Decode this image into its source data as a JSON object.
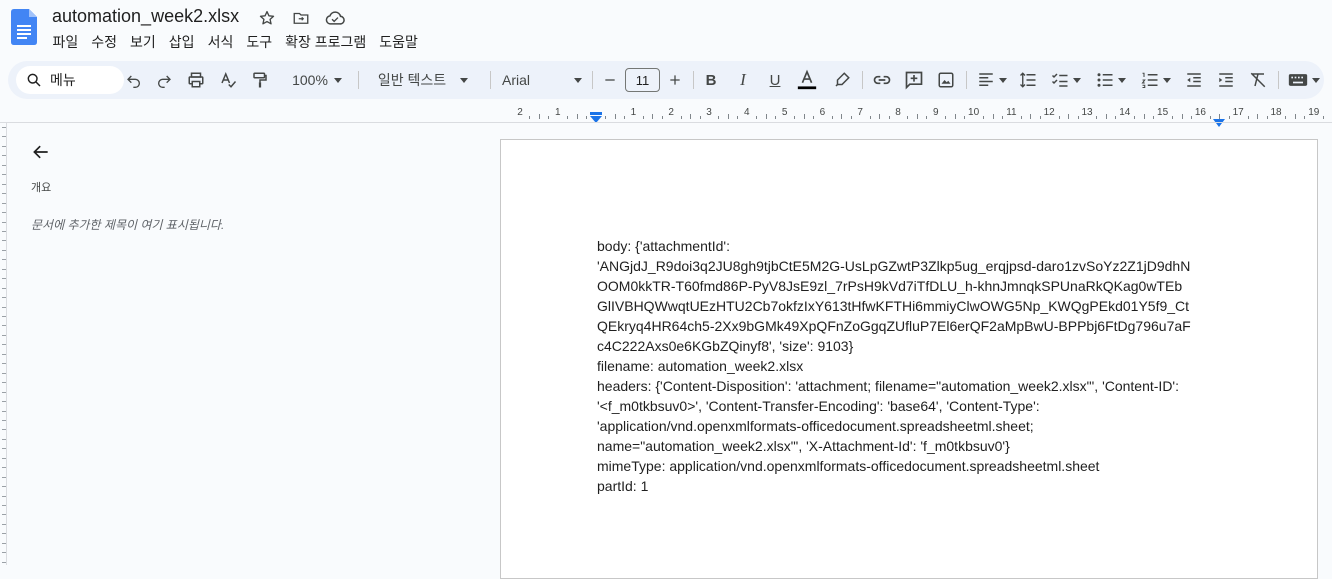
{
  "header": {
    "title": "automation_week2.xlsx",
    "icons": [
      "star-icon",
      "move-to-folder-icon",
      "cloud-status-icon"
    ]
  },
  "menu": [
    "파일",
    "수정",
    "보기",
    "삽입",
    "서식",
    "도구",
    "확장 프로그램",
    "도움말"
  ],
  "toolbar": {
    "search_label": "메뉴",
    "zoom": "100%",
    "style": "일반 텍스트",
    "font": "Arial",
    "font_size": "11",
    "text_color": "#000000"
  },
  "ruler": {
    "numbers": [
      "2",
      "1",
      "",
      "1",
      "2",
      "3",
      "4",
      "5",
      "6",
      "7",
      "8",
      "9",
      "10",
      "11",
      "12",
      "13",
      "14",
      "15",
      "16",
      "17",
      "18",
      "19"
    ]
  },
  "outline": {
    "label": "개요",
    "empty_text": "문서에 추가한 제목이 여기 표시됩니다."
  },
  "document": {
    "lines": [
      "body: {'attachmentId':",
      "'ANGjdJ_R9doi3q2JU8gh9tjbCtE5M2G-UsLpGZwtP3Zlkp5ug_erqjpsd-daro1zvSoYz2Z1jD9dhN",
      "OOM0kkTR-T60fmd86P-PyV8JsE9zl_7rPsH9kVd7iTfDLU_h-khnJmnqkSPUnaRkQKag0wTEb",
      "GlIVBHQWwqtUEzHTU2Cb7okfzIxY613tHfwKFTHi6mmiyClwOWG5Np_KWQgPEkd01Y5f9_Ct",
      "QEkryq4HR64ch5-2Xx9bGMk49XpQFnZoGgqZUfluP7El6erQF2aMpBwU-BPPbj6FtDg796u7aF",
      "c4C222Axs0e6KGbZQinyf8', 'size': 9103}",
      "filename: automation_week2.xlsx",
      "headers: {'Content-Disposition': 'attachment; filename=\"automation_week2.xlsx\"', 'Content-ID':",
      "'<f_m0tkbsuv0>', 'Content-Transfer-Encoding': 'base64', 'Content-Type':",
      "'application/vnd.openxmlformats-officedocument.spreadsheetml.sheet;",
      "name=\"automation_week2.xlsx\"', 'X-Attachment-Id': 'f_m0tkbsuv0'}",
      "mimeType: application/vnd.openxmlformats-officedocument.spreadsheetml.sheet",
      "partId: 1"
    ]
  }
}
